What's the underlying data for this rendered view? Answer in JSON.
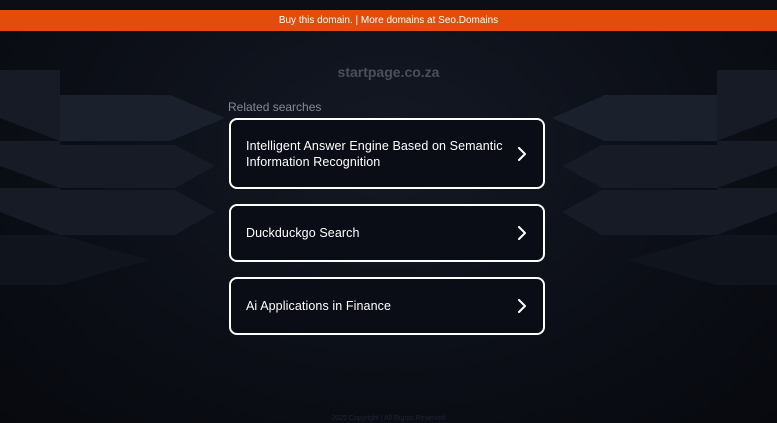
{
  "banner": {
    "text": "Buy this domain. | More domains at Seo.Domains",
    "color": "#e34d0b"
  },
  "domain": {
    "title": "startpage.co.za"
  },
  "related": {
    "heading": "Related searches",
    "items": [
      {
        "label": "Intelligent Answer Engine Based on Semantic Information Recognition",
        "icon": "chevron-right-icon"
      },
      {
        "label": "Duckduckgo Search",
        "icon": "chevron-right-icon"
      },
      {
        "label": "Ai Applications in Finance",
        "icon": "chevron-right-icon"
      }
    ]
  },
  "footer": {
    "text": "2025 Copyright | All Rights Reserved"
  }
}
